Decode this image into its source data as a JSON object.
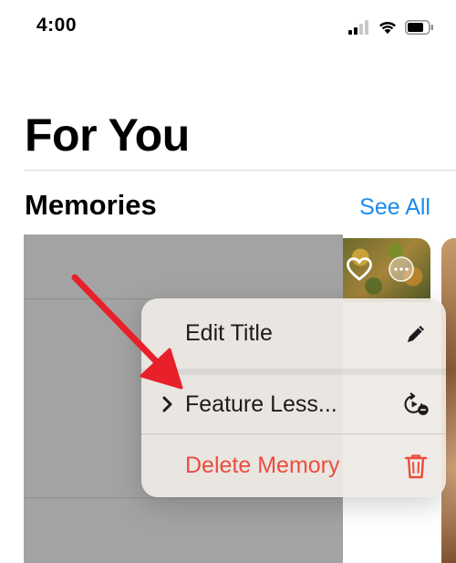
{
  "status_bar": {
    "time": "4:00",
    "icons": [
      "signal-icon",
      "wifi-icon",
      "battery-icon"
    ]
  },
  "header": {
    "title": "For You"
  },
  "memories": {
    "section_title": "Memories",
    "see_all_label": "See All",
    "thumbnail_icons": [
      "heart-icon",
      "more-icon"
    ]
  },
  "context_menu": {
    "items": [
      {
        "label": "Edit Title",
        "icon": "pencil-icon",
        "color": "#1c1c1e",
        "has_submenu": false
      },
      {
        "label": "Feature Less...",
        "icon": "feature-less-icon",
        "color": "#1c1c1e",
        "has_submenu": true
      },
      {
        "label": "Delete Memory",
        "icon": "trash-icon",
        "color": "#eb4d3d",
        "has_submenu": false
      }
    ]
  },
  "colors": {
    "accent": "#1a8cf0",
    "destructive": "#eb4d3d",
    "annotation_arrow": "#e8202a"
  }
}
